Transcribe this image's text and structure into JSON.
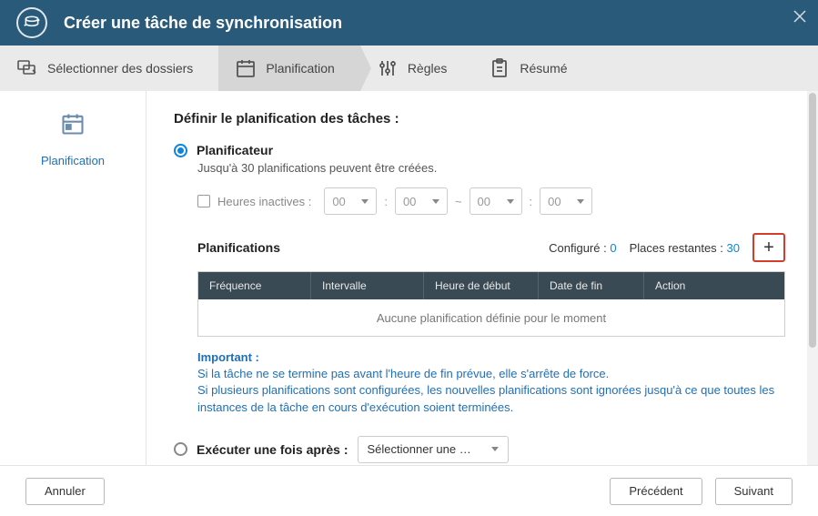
{
  "title": "Créer une tâche de synchronisation",
  "steps": {
    "select_folders": "Sélectionner des dossiers",
    "planning": "Planification",
    "rules": "Règles",
    "summary": "Résumé"
  },
  "sidebar": {
    "label": "Planification"
  },
  "section": {
    "title": "Définir le planification des tâches :"
  },
  "scheduler": {
    "label": "Planificateur",
    "desc": "Jusqu'à 30 planifications peuvent être créées.",
    "inactive_label": "Heures inactives :",
    "h1": "00",
    "m1": "00",
    "h2": "00",
    "m2": "00",
    "plans_title": "Planifications",
    "configured_label": "Configuré :",
    "configured_value": "0",
    "remaining_label": "Places restantes :",
    "remaining_value": "30",
    "table": {
      "freq": "Fréquence",
      "interval": "Intervalle",
      "start": "Heure de début",
      "end": "Date de fin",
      "action": "Action",
      "empty": "Aucune planification définie pour le moment"
    },
    "important_label": "Important :",
    "important_line1": "Si la tâche ne se termine pas avant l'heure de fin prévue, elle s'arrête de force.",
    "important_line2": "Si plusieurs planifications sont configurées, les nouvelles planifications sont ignorées jusqu'à ce que toutes les instances de la tâche en cours d'exécution soient terminées."
  },
  "exec_once": {
    "label": "Exécuter une fois après :",
    "placeholder": "Sélectionner une …"
  },
  "footer": {
    "cancel": "Annuler",
    "prev": "Précédent",
    "next": "Suivant"
  }
}
